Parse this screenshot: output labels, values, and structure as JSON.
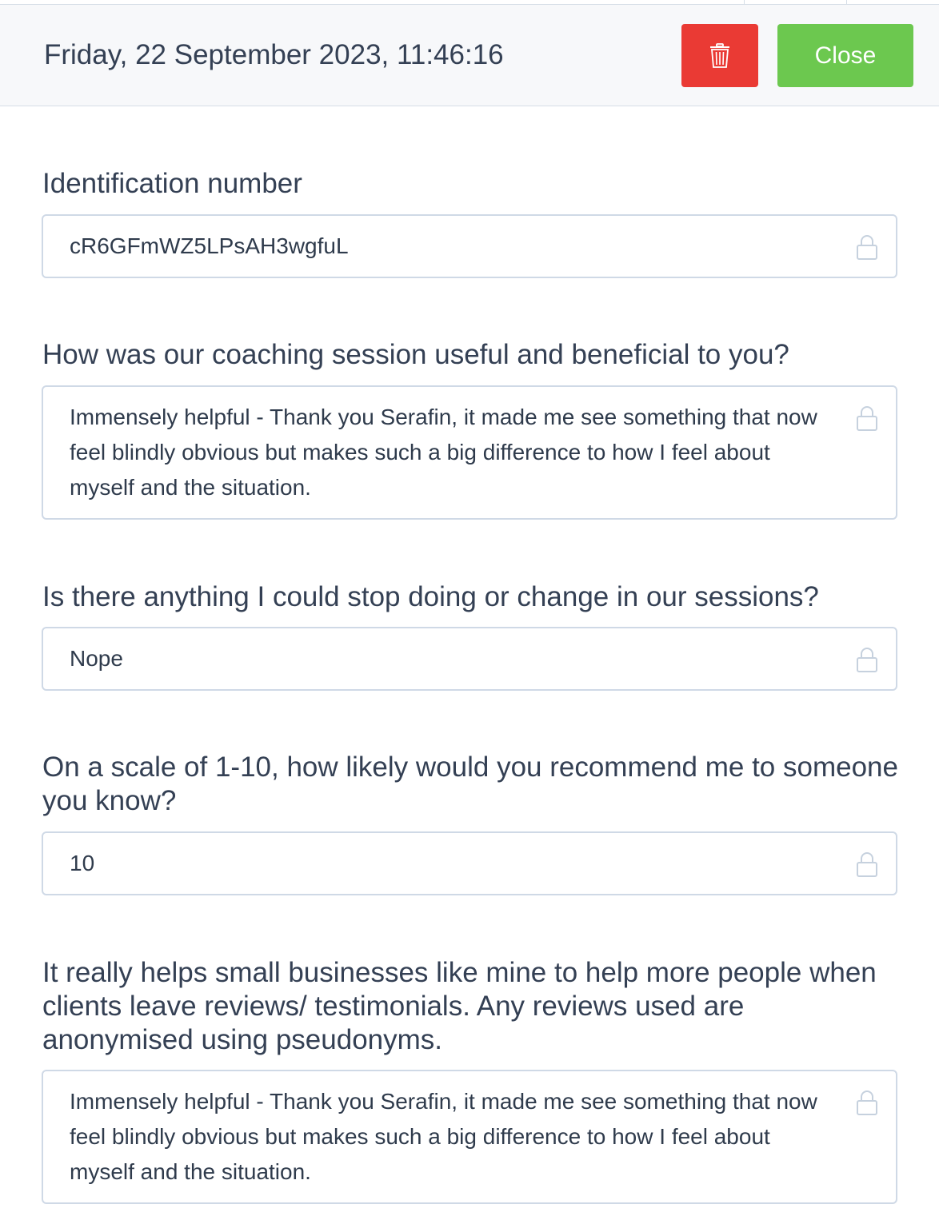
{
  "header": {
    "title": "Friday, 22 September 2023, 11:46:16",
    "delete_icon": "trash-icon",
    "close_label": "Close",
    "delete_color": "#ea3a34",
    "close_color": "#6cc84f"
  },
  "fields": [
    {
      "label": "Identification number",
      "value": "cR6GFmWZ5LPsAH3wgfuL",
      "icon": "lock-icon"
    },
    {
      "label": "How was our coaching session useful and beneficial to you?",
      "value": "Immensely helpful - Thank you Serafin, it made me see something that now feel blindly obvious but makes such a big difference to how I feel about myself and the situation.",
      "icon": "lock-icon"
    },
    {
      "label": "Is there anything I could stop doing or change in our sessions?",
      "value": "Nope",
      "icon": "lock-icon"
    },
    {
      "label": "On a scale of 1-10, how likely would you recommend me to someone you know?",
      "value": "10",
      "icon": "lock-icon"
    },
    {
      "label": "It really helps small businesses like mine to help more people when clients leave reviews/ testimonials. Any reviews used are anonymised using pseudonyms.",
      "value": "Immensely helpful - Thank you Serafin, it made me see something that now feel blindly obvious but makes such a big difference to how I feel about myself and the situation.",
      "icon": "lock-icon"
    }
  ]
}
